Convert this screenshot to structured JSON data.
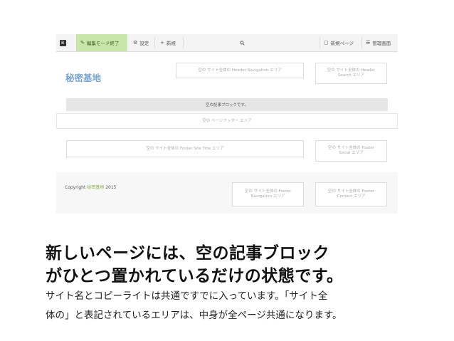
{
  "toolbar": {
    "logo": "B",
    "edit_mode_label": "編集モード終了",
    "settings_label": "設定",
    "new_label": "新規",
    "new_page_label": "新規ページ",
    "admin_label": "管理画面"
  },
  "site": {
    "title": "秘密基地",
    "header_nav_area": "空の サイト全体の Header Navigation エリア",
    "header_search_area_line1": "空の サイト全体の Header",
    "header_search_area_line2": "Search エリア",
    "empty_block": "空の記事ブロックです。",
    "page_footer_area": "空の ページフッター エリア",
    "footer_site_title_area": "空の サイト全体の Footer Site Title エリア",
    "footer_social_area_line1": "空の サイト全体の Footer",
    "footer_social_area_line2": "Social エリア",
    "copyright_prefix": "Copyright",
    "copyright_name": "秘密基地",
    "copyright_year": "2015",
    "footer_nav_area_line1": "空の サイト全体の Footer",
    "footer_nav_area_line2": "Navigation エリア",
    "footer_contact_area_line1": "空の サイト全体の Footer",
    "footer_contact_area_line2": "Contact エリア"
  },
  "caption": {
    "line1": "新しいページには、空の記事ブロック",
    "line2": "がひとつ置かれているだけの状態です。",
    "line3": "サイト名とコピーライトは共通ですでに入っています。「サイト全",
    "line4": "体の」と表記されているエリアは、中身が全ページ共通になります。"
  },
  "icons": {
    "edit": "pencil-icon",
    "settings": "gear-icon",
    "new": "plus-icon",
    "search": "search-icon",
    "new_page": "new-page-icon",
    "admin": "sliders-icon"
  },
  "colors": {
    "edit_mode_bg": "#c9e6a9",
    "site_title": "#7aa6cf",
    "copyright_accent": "#8ab04a"
  }
}
